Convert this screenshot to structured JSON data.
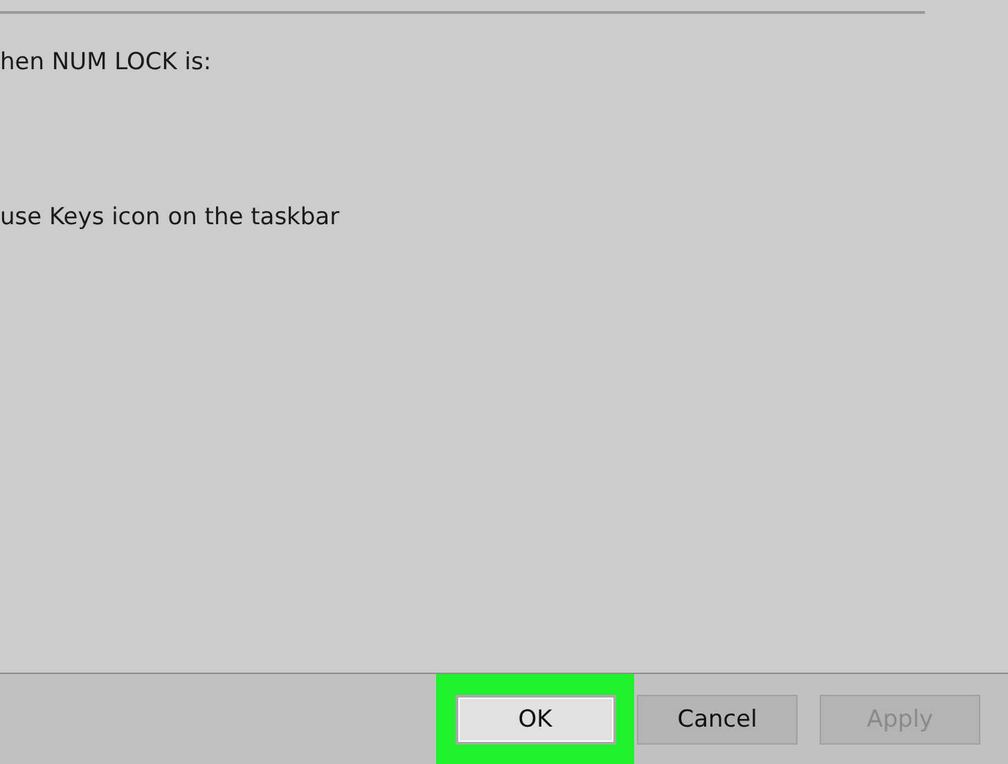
{
  "lines": [
    "hen NUM LOCK is:",
    "use Keys icon on the taskbar"
  ],
  "buttons": [
    {
      "label": "OK",
      "highlighted": true,
      "disabled": false
    },
    {
      "label": "Cancel",
      "highlighted": false,
      "disabled": false
    },
    {
      "label": "Apply",
      "highlighted": false,
      "disabled": true
    }
  ]
}
